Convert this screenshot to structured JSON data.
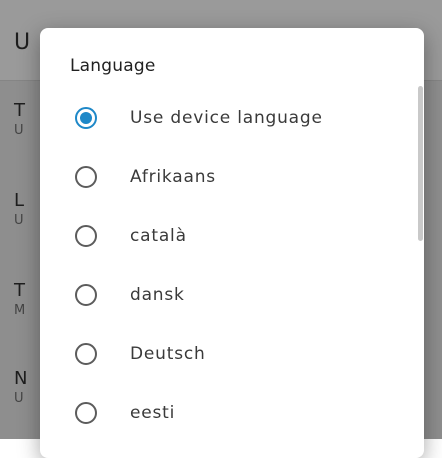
{
  "background": {
    "appbar_title": "U",
    "items": [
      {
        "title": "T",
        "subtitle": "U"
      },
      {
        "title": "L",
        "subtitle": "U"
      },
      {
        "title": "T",
        "subtitle": "M"
      },
      {
        "title": "N",
        "subtitle": "U"
      }
    ]
  },
  "dialog": {
    "title": "Language",
    "options": [
      {
        "label": "Use device language",
        "checked": true
      },
      {
        "label": "Afrikaans",
        "checked": false
      },
      {
        "label": "català",
        "checked": false
      },
      {
        "label": "dansk",
        "checked": false
      },
      {
        "label": "Deutsch",
        "checked": false
      },
      {
        "label": "eesti",
        "checked": false
      }
    ]
  },
  "colors": {
    "accent": "#1e88c8",
    "radio_unchecked": "#5c5c5c",
    "scrim": "#8e8e8e"
  }
}
